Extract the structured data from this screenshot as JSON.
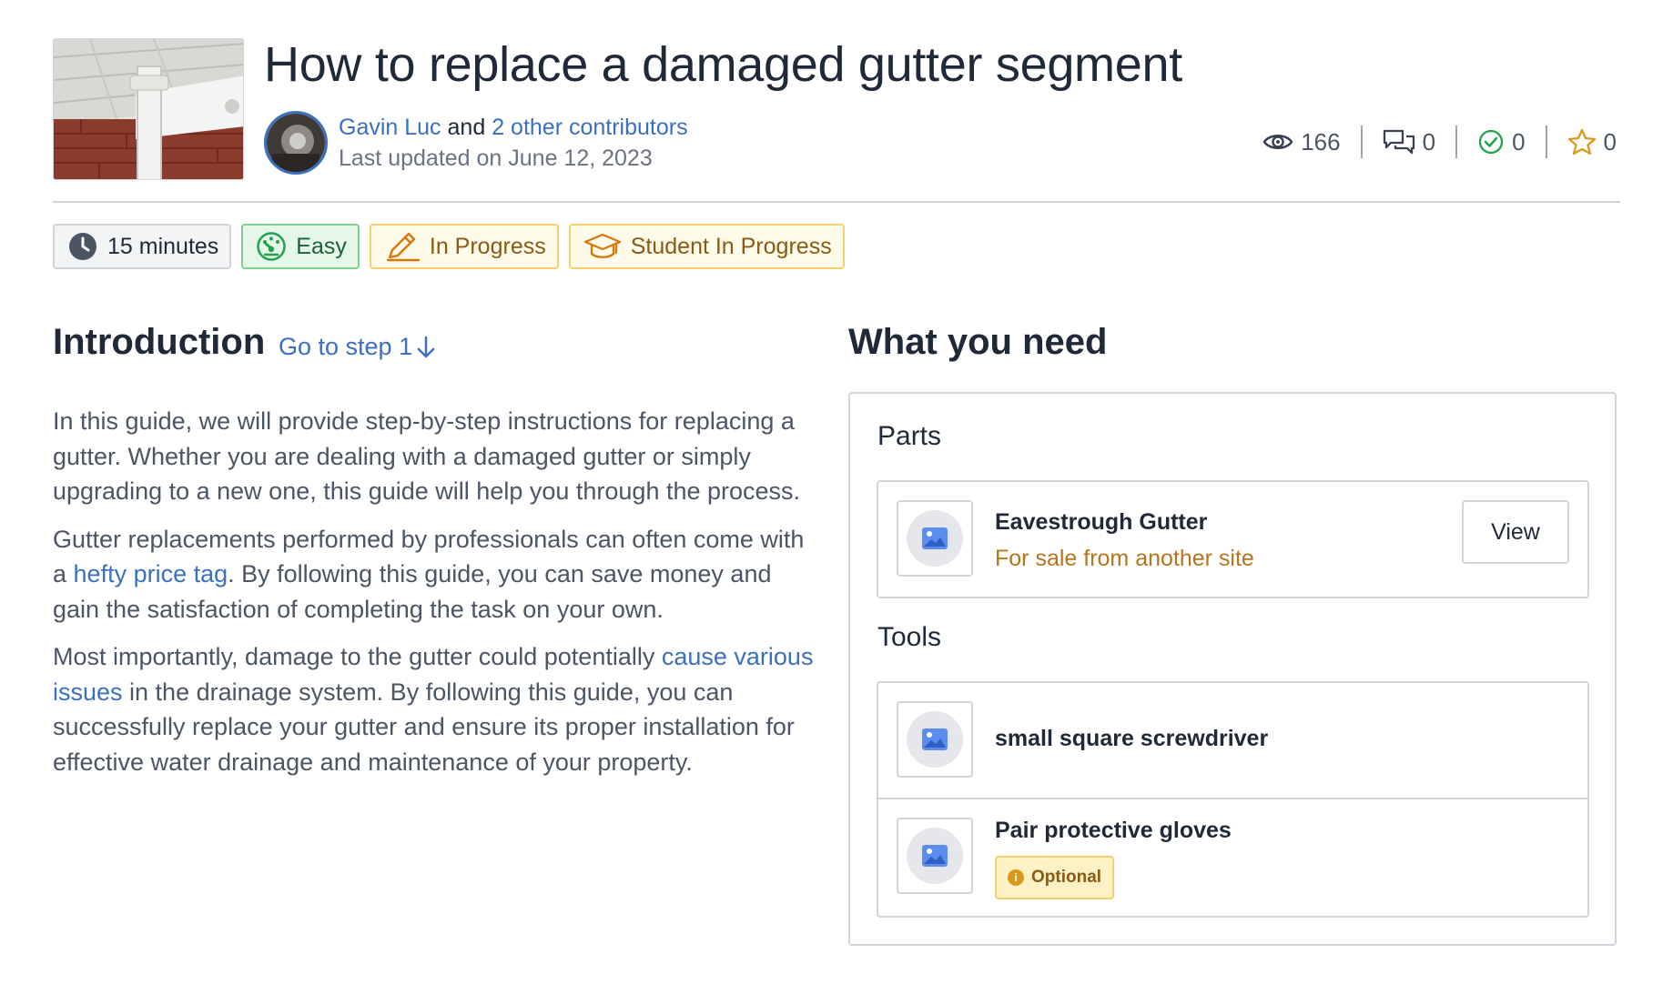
{
  "guide": {
    "title": "How to replace a damaged gutter segment",
    "author": "Gavin Luc",
    "and_text": "and",
    "contributors_link": "2 other contributors",
    "last_updated": "Last updated on June 12, 2023"
  },
  "stats": {
    "views": "166",
    "comments": "0",
    "completed": "0",
    "favorites": "0"
  },
  "badges": {
    "time": "15 minutes",
    "difficulty": "Easy",
    "status": "In Progress",
    "author_type": "Student In Progress"
  },
  "introduction": {
    "heading": "Introduction",
    "goto_link": "Go to step 1",
    "p1": "In this guide, we will provide step-by-step instructions for replacing a gutter. Whether you are dealing with a damaged gutter or simply upgrading to a new one, this guide will help you through the process.",
    "p2_before": "Gutter replacements performed by professionals can often come with a ",
    "p2_link": "hefty price tag",
    "p2_after": ". By following this guide, you can save money and gain the satisfaction of completing the task on your own.",
    "p3_before": "Most importantly, damage to the gutter could potentially ",
    "p3_link": "cause various issues",
    "p3_after": " in the drainage system. By following this guide, you can successfully replace your gutter and ensure its proper installation for effective water drainage and maintenance of your property."
  },
  "what_you_need": {
    "heading": "What you need",
    "parts_label": "Parts",
    "parts": [
      {
        "name": "Eavestrough Gutter",
        "subtitle": "For sale from another site",
        "button": "View"
      }
    ],
    "tools_label": "Tools",
    "tools": [
      {
        "name": "small square screwdriver"
      },
      {
        "name": "Pair protective gloves",
        "badge": "Optional"
      }
    ]
  },
  "colors": {
    "link": "#3b6fc0",
    "difficulty_green": "#22a24a",
    "status_amber": "#d99a1a",
    "part_source": "#b8741a"
  },
  "icons": {
    "views": "eye-icon",
    "comments": "comments-icon",
    "completed": "check-circle-icon",
    "favorites": "star-icon",
    "time": "clock-icon",
    "difficulty": "gauge-icon",
    "status": "pencil-icon",
    "author_type": "graduation-cap-icon",
    "placeholder": "image-placeholder-icon",
    "goto": "arrow-down-icon",
    "optional": "info-icon"
  }
}
